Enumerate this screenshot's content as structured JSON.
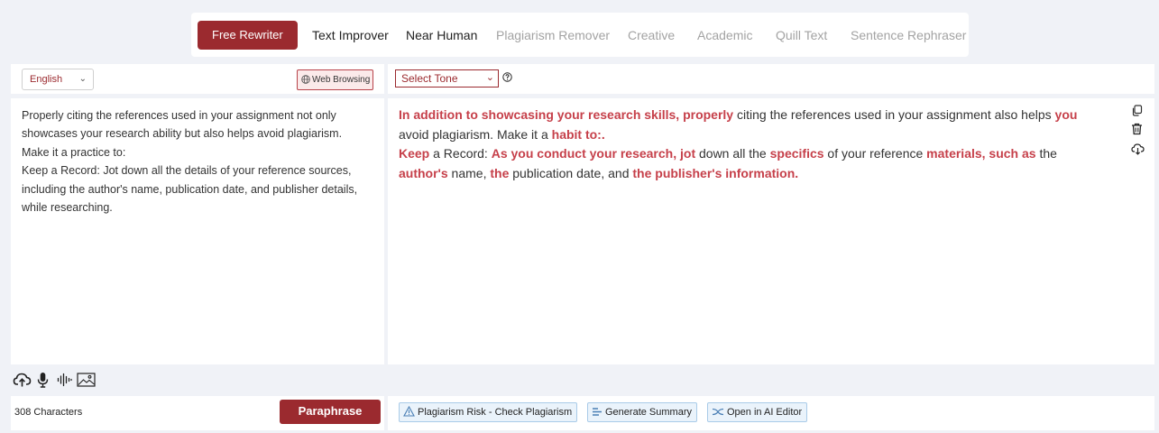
{
  "modes": [
    {
      "label": "Free Rewriter",
      "state": "active"
    },
    {
      "label": "Text Improver",
      "state": "normal"
    },
    {
      "label": "Near Human",
      "state": "normal"
    },
    {
      "label": "Plagiarism Remover",
      "state": "muted"
    },
    {
      "label": "Creative",
      "state": "muted"
    },
    {
      "label": "Academic",
      "state": "muted"
    },
    {
      "label": "Quill Text",
      "state": "muted"
    },
    {
      "label": "Sentence Rephraser",
      "state": "muted"
    }
  ],
  "input_panel": {
    "language": "English",
    "web_browsing_label": "Web Browsing",
    "lines": [
      "Properly citing the references used in your assignment not only",
      "showcases your research ability but also helps avoid plagiarism.",
      "Make it a practice to:",
      "Keep a Record: Jot down all the details of your reference sources,",
      "including the author's name, publication date, and publisher details,",
      "while researching."
    ],
    "char_count": "308 Characters",
    "paraphrase_label": "Paraphrase"
  },
  "output_panel": {
    "tone_placeholder": "Select Tone",
    "lines": [
      [
        {
          "t": "In addition to showcasing your research skills, properly",
          "h": true
        },
        {
          "t": " citing the references used in your assignment also helps ",
          "h": false
        },
        {
          "t": "you",
          "h": true
        }
      ],
      [
        {
          "t": "avoid plagiarism. Make it a ",
          "h": false
        },
        {
          "t": "habit to:.",
          "h": true
        }
      ],
      [
        {
          "t": "Keep",
          "h": true
        },
        {
          "t": " a Record: ",
          "h": false
        },
        {
          "t": "As you conduct your research, jot",
          "h": true
        },
        {
          "t": " down all the ",
          "h": false
        },
        {
          "t": "specifics",
          "h": true
        },
        {
          "t": " of your reference ",
          "h": false
        },
        {
          "t": "materials, such as",
          "h": true
        },
        {
          "t": " the",
          "h": false
        }
      ],
      [
        {
          "t": "author's",
          "h": true
        },
        {
          "t": " name, ",
          "h": false
        },
        {
          "t": "the",
          "h": true
        },
        {
          "t": " publication date, and ",
          "h": false
        },
        {
          "t": "the publisher's information.",
          "h": true
        }
      ]
    ],
    "actions": [
      {
        "label": "Plagiarism Risk - Check Plagiarism",
        "icon": "warning-icon"
      },
      {
        "label": "Generate Summary",
        "icon": "summary-icon"
      },
      {
        "label": "Open in AI Editor",
        "icon": "ai-editor-icon"
      }
    ]
  },
  "colors": {
    "brand": "#9b2a2f",
    "highlight": "#c6404a",
    "chip_border": "#a9cbe8",
    "chip_bg": "#eaf3fb"
  }
}
